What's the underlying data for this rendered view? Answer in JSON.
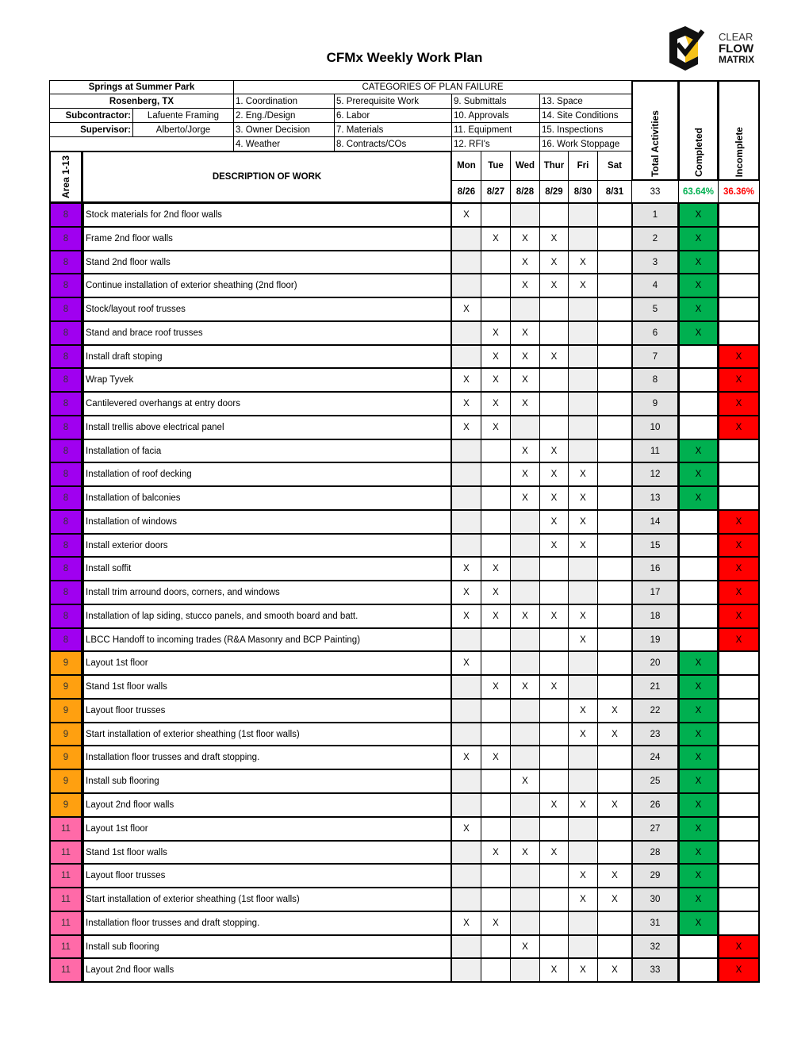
{
  "title": "CFMx Weekly Work Plan",
  "logo": {
    "line1": "CLEAR",
    "line2": "FLOW",
    "line3": "MATRIX"
  },
  "project": {
    "name": "Springs at Summer Park",
    "location": "Rosenberg, TX",
    "subcontractor_label": "Subcontractor:",
    "subcontractor": "Lafuente Framing",
    "supervisor_label": "Supervisor:",
    "supervisor": "Alberto/Jorge"
  },
  "categories": {
    "title": "CATEGORIES OF PLAN FAILURE",
    "items": [
      "1. Coordination",
      "5. Prerequisite Work",
      "9. Submittals",
      "13. Space",
      "2. Eng./Design",
      "6. Labor",
      "10. Approvals",
      "14. Site Conditions",
      "3. Owner Decision",
      "7. Materials",
      "11. Equipment",
      "15. Inspections",
      "4. Weather",
      "8. Contracts/COs",
      "12. RFI's",
      "16. Work Stoppage"
    ]
  },
  "headers": {
    "area": "Area 1-13",
    "description": "DESCRIPTION OF WORK",
    "days": [
      "Mon",
      "Tue",
      "Wed",
      "Thur",
      "Fri",
      "Sat"
    ],
    "dates": [
      "8/26",
      "8/27",
      "8/28",
      "8/29",
      "8/30",
      "8/31"
    ],
    "total": "Total Activities",
    "completed": "Completed",
    "incomplete": "Incomplete"
  },
  "summary": {
    "total": "33",
    "completed_pct": "63.64%",
    "incomplete_pct": "36.36%"
  },
  "colors": {
    "area8": "#a000f0",
    "area9": "#ffa010",
    "area11": "#ff6aa8",
    "complete": "#00b050",
    "incomplete": "#ff0000",
    "completed_text": "#00b050",
    "incomplete_text": "#ff0000"
  },
  "mark": "X",
  "rows": [
    {
      "area": "8",
      "desc": "Stock materials for 2nd floor walls",
      "days": [
        1,
        0,
        0,
        0,
        0,
        0
      ],
      "num": "1",
      "done": true
    },
    {
      "area": "8",
      "desc": "Frame 2nd floor walls",
      "days": [
        0,
        1,
        1,
        1,
        0,
        0
      ],
      "num": "2",
      "done": true
    },
    {
      "area": "8",
      "desc": "Stand 2nd floor walls",
      "days": [
        0,
        0,
        1,
        1,
        1,
        0
      ],
      "num": "3",
      "done": true
    },
    {
      "area": "8",
      "desc": "Continue installation of exterior sheathing (2nd floor)",
      "days": [
        0,
        0,
        1,
        1,
        1,
        0
      ],
      "num": "4",
      "done": true
    },
    {
      "area": "8",
      "desc": "Stock/layout roof trusses",
      "days": [
        1,
        0,
        0,
        0,
        0,
        0
      ],
      "num": "5",
      "done": true
    },
    {
      "area": "8",
      "desc": "Stand and brace roof trusses",
      "days": [
        0,
        1,
        1,
        0,
        0,
        0
      ],
      "num": "6",
      "done": true
    },
    {
      "area": "8",
      "desc": "Install draft stoping",
      "days": [
        0,
        1,
        1,
        1,
        0,
        0
      ],
      "num": "7",
      "done": false
    },
    {
      "area": "8",
      "desc": "Wrap Tyvek",
      "days": [
        1,
        1,
        1,
        0,
        0,
        0
      ],
      "num": "8",
      "done": false
    },
    {
      "area": "8",
      "desc": "Cantilevered overhangs at entry doors",
      "days": [
        1,
        1,
        1,
        0,
        0,
        0
      ],
      "num": "9",
      "done": false
    },
    {
      "area": "8",
      "desc": "Install trellis above electrical panel",
      "days": [
        1,
        1,
        0,
        0,
        0,
        0
      ],
      "num": "10",
      "done": false
    },
    {
      "area": "8",
      "desc": "Installation of facia",
      "days": [
        0,
        0,
        1,
        1,
        0,
        0
      ],
      "num": "11",
      "done": true
    },
    {
      "area": "8",
      "desc": "Installation of roof decking",
      "days": [
        0,
        0,
        1,
        1,
        1,
        0
      ],
      "num": "12",
      "done": true
    },
    {
      "area": "8",
      "desc": "Installation of balconies",
      "days": [
        0,
        0,
        1,
        1,
        1,
        0
      ],
      "num": "13",
      "done": true
    },
    {
      "area": "8",
      "desc": "Installation of windows",
      "days": [
        0,
        0,
        0,
        1,
        1,
        0
      ],
      "num": "14",
      "done": false
    },
    {
      "area": "8",
      "desc": "Install exterior doors",
      "days": [
        0,
        0,
        0,
        1,
        1,
        0
      ],
      "num": "15",
      "done": false
    },
    {
      "area": "8",
      "desc": "Install soffit",
      "days": [
        1,
        1,
        0,
        0,
        0,
        0
      ],
      "num": "16",
      "done": false
    },
    {
      "area": "8",
      "desc": "Install trim arround doors, corners, and windows",
      "days": [
        1,
        1,
        0,
        0,
        0,
        0
      ],
      "num": "17",
      "done": false
    },
    {
      "area": "8",
      "desc": "Installation of lap siding, stucco panels, and smooth board and batt.",
      "days": [
        1,
        1,
        1,
        1,
        1,
        0
      ],
      "num": "18",
      "done": false
    },
    {
      "area": "8",
      "desc": "LBCC Handoff to incoming trades (R&A Masonry and BCP Painting)",
      "days": [
        0,
        0,
        0,
        0,
        1,
        0
      ],
      "num": "19",
      "done": false
    },
    {
      "area": "9",
      "desc": "Layout 1st floor",
      "days": [
        1,
        0,
        0,
        0,
        0,
        0
      ],
      "num": "20",
      "done": true
    },
    {
      "area": "9",
      "desc": "Stand 1st floor walls",
      "days": [
        0,
        1,
        1,
        1,
        0,
        0
      ],
      "num": "21",
      "done": true
    },
    {
      "area": "9",
      "desc": "Layout floor trusses",
      "days": [
        0,
        0,
        0,
        0,
        1,
        1
      ],
      "num": "22",
      "done": true
    },
    {
      "area": "9",
      "desc": "Start installation of exterior sheathing (1st floor walls)",
      "days": [
        0,
        0,
        0,
        0,
        1,
        1
      ],
      "num": "23",
      "done": true
    },
    {
      "area": "9",
      "desc": "Installation floor trusses and draft stopping.",
      "days": [
        1,
        1,
        0,
        0,
        0,
        0
      ],
      "num": "24",
      "done": true
    },
    {
      "area": "9",
      "desc": "Install sub flooring",
      "days": [
        0,
        0,
        1,
        0,
        0,
        0
      ],
      "num": "25",
      "done": true
    },
    {
      "area": "9",
      "desc": "Layout 2nd floor walls",
      "days": [
        0,
        0,
        0,
        1,
        1,
        1
      ],
      "num": "26",
      "done": true
    },
    {
      "area": "11",
      "desc": "Layout 1st floor",
      "days": [
        1,
        0,
        0,
        0,
        0,
        0
      ],
      "num": "27",
      "done": true
    },
    {
      "area": "11",
      "desc": "Stand 1st floor walls",
      "days": [
        0,
        1,
        1,
        1,
        0,
        0
      ],
      "num": "28",
      "done": true
    },
    {
      "area": "11",
      "desc": "Layout floor trusses",
      "days": [
        0,
        0,
        0,
        0,
        1,
        1
      ],
      "num": "29",
      "done": true
    },
    {
      "area": "11",
      "desc": "Start installation of exterior sheathing (1st floor walls)",
      "days": [
        0,
        0,
        0,
        0,
        1,
        1
      ],
      "num": "30",
      "done": true
    },
    {
      "area": "11",
      "desc": "Installation floor trusses and draft stopping.",
      "days": [
        1,
        1,
        0,
        0,
        0,
        0
      ],
      "num": "31",
      "done": true
    },
    {
      "area": "11",
      "desc": "Install sub flooring",
      "days": [
        0,
        0,
        1,
        0,
        0,
        0
      ],
      "num": "32",
      "done": false
    },
    {
      "area": "11",
      "desc": "Layout 2nd floor walls",
      "days": [
        0,
        0,
        0,
        1,
        1,
        1
      ],
      "num": "33",
      "done": false
    }
  ]
}
